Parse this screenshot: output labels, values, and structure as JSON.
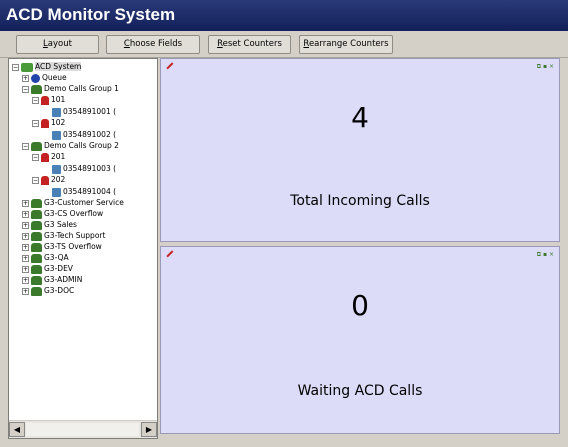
{
  "window": {
    "title": "ACD Monitor System"
  },
  "toolbar": {
    "layout": "Layout",
    "choose_fields": "Choose Fields",
    "reset_counters": "Reset Counters",
    "rearrange_counters": "Rearrange Counters"
  },
  "tree": {
    "root": "ACD System",
    "queue": "Queue",
    "group1": "Demo Calls Group 1",
    "agent_101": "101",
    "phone_101": "0354891001 (",
    "agent_102": "102",
    "phone_102": "0354891002 (",
    "group2": "Demo Calls Group 2",
    "agent_201": "201",
    "phone_201": "0354891003 (",
    "agent_202": "202",
    "phone_202": "0354891004 (",
    "others": [
      "G3-Customer Service",
      "G3-CS Overflow",
      "G3 Sales",
      "G3-Tech Support",
      "G3-TS Overflow",
      "G3-QA",
      "G3-DEV",
      "G3-ADMIN",
      "G3-DOC"
    ]
  },
  "counters": {
    "incoming": {
      "value": "4",
      "label": "Total Incoming Calls"
    },
    "waiting": {
      "value": "0",
      "label": "Waiting ACD Calls"
    }
  },
  "colors": {
    "titlebar": "#1b2a66",
    "panel_bg": "#dcdcf8"
  }
}
